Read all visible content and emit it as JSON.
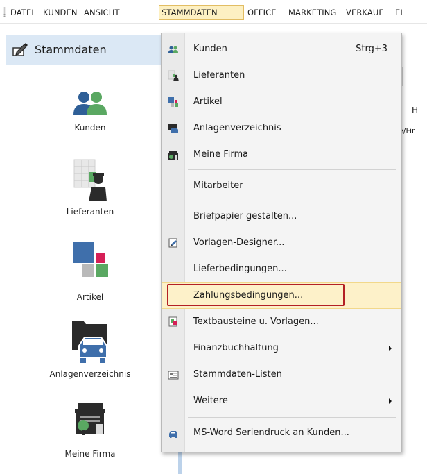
{
  "menubar": {
    "items": [
      "DATEI",
      "KUNDEN",
      "ANSICHT",
      "STAMMDATEN",
      "OFFICE",
      "MARKETING",
      "VERKAUF",
      "EI"
    ],
    "active_index": 3
  },
  "sidebar": {
    "title": "Stammdaten",
    "title_icon": "edit-icon",
    "items": [
      {
        "label": "Kunden",
        "icon": "people-icon"
      },
      {
        "label": "Lieferanten",
        "icon": "supplier-icon"
      },
      {
        "label": "Artikel",
        "icon": "article-icon"
      },
      {
        "label": "Anlagenverzeichnis",
        "icon": "asset-icon"
      },
      {
        "label": "Meine Firma",
        "icon": "company-icon"
      }
    ]
  },
  "background": {
    "header_letter": "H",
    "column_text": "ne/Fir"
  },
  "dropdown": {
    "items": [
      {
        "label": "Kunden",
        "shortcut": "Strg+3",
        "icon": "people-icon"
      },
      {
        "label": "Lieferanten",
        "icon": "supplier-icon"
      },
      {
        "label": "Artikel",
        "icon": "article-icon"
      },
      {
        "label": "Anlagenverzeichnis",
        "icon": "asset-icon"
      },
      {
        "label": "Meine Firma",
        "icon": "company-icon"
      },
      {
        "label": "Mitarbeiter"
      },
      {
        "label": "Briefpapier gestalten..."
      },
      {
        "label": "Vorlagen-Designer...",
        "icon": "designer-icon"
      },
      {
        "label": "Lieferbedingungen..."
      },
      {
        "label": "Zahlungsbedingungen...",
        "highlighted": true
      },
      {
        "label": "Textbausteine u. Vorlagen...",
        "icon": "text-modules-icon"
      },
      {
        "label": "Finanzbuchhaltung",
        "submenu": true
      },
      {
        "label": "Stammdaten-Listen",
        "icon": "list-icon"
      },
      {
        "label": "Weitere",
        "submenu": true
      },
      {
        "label": "MS-Word Seriendruck an Kunden...",
        "icon": "car-icon"
      }
    ]
  },
  "colors": {
    "accent_highlight": "#fdf1c9",
    "outline_red": "#b32025",
    "panel_header": "#dbe8f5"
  }
}
